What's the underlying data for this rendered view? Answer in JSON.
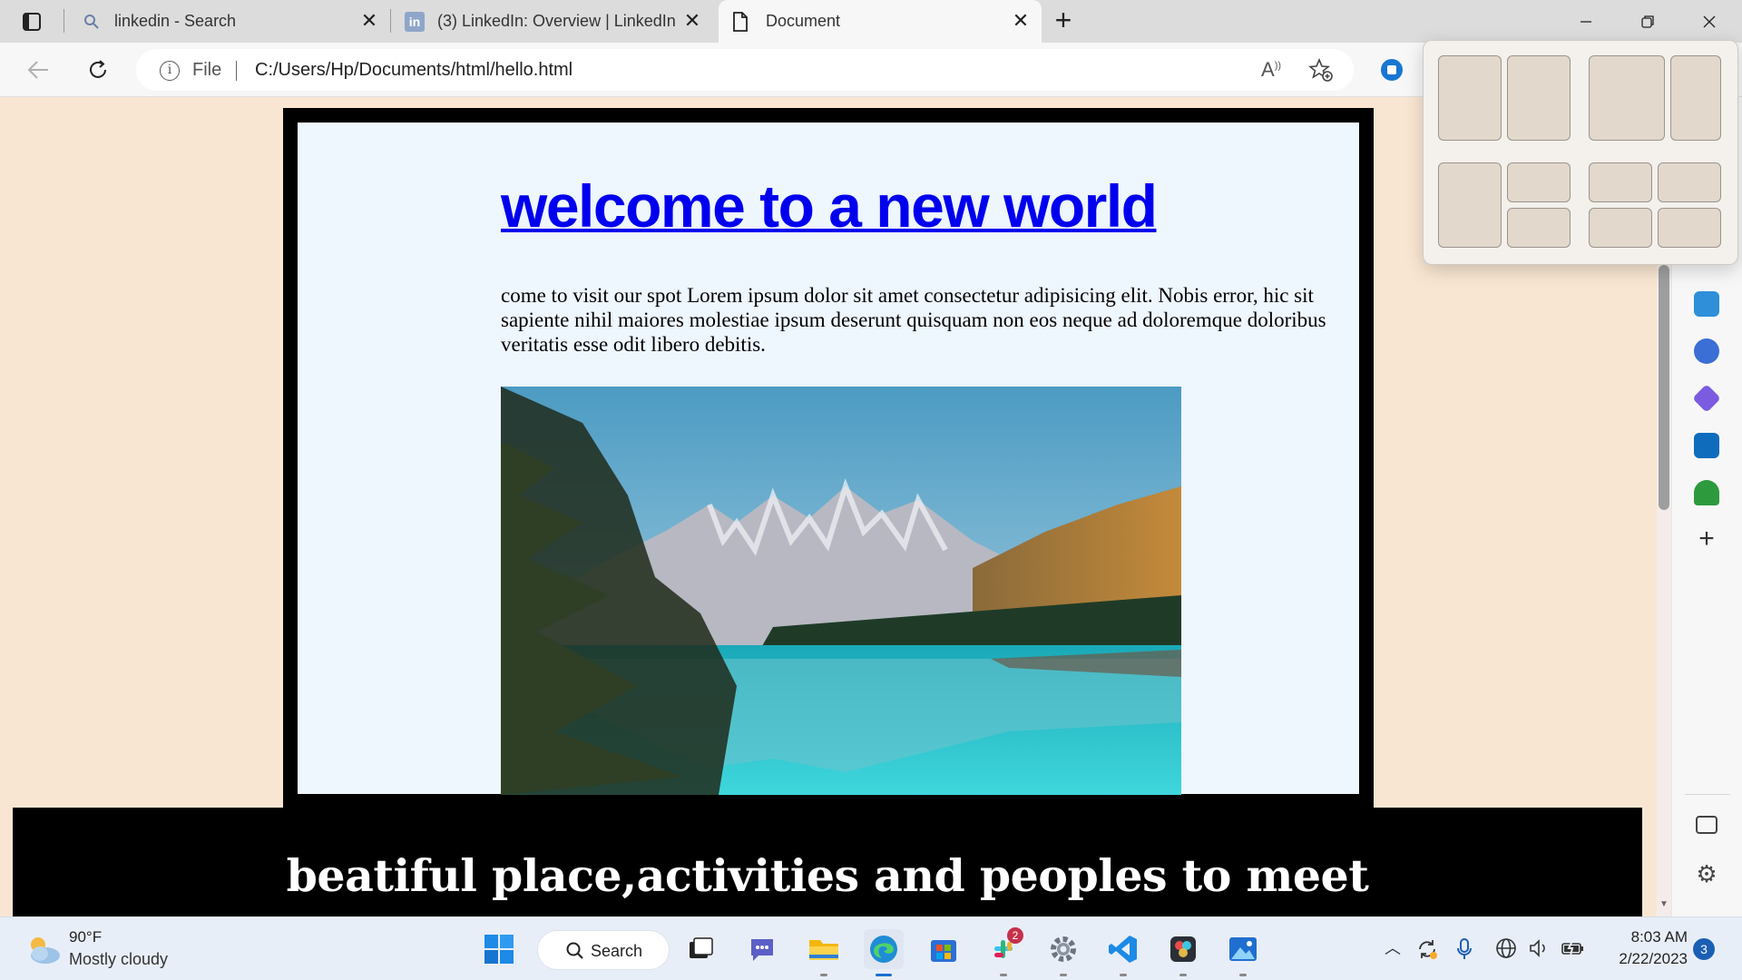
{
  "browser": {
    "tabs": [
      {
        "title": "linkedin - Search",
        "icon": "search-icon",
        "active": false
      },
      {
        "title": "(3) LinkedIn: Overview | LinkedIn",
        "icon": "linkedin-icon",
        "active": false
      },
      {
        "title": "Document",
        "icon": "document-icon",
        "active": true
      }
    ],
    "address": {
      "scheme": "File",
      "url": "C:/Users/Hp/Documents/html/hello.html"
    },
    "close_glyph": "✕"
  },
  "page": {
    "heading": "welcome to a new world",
    "paragraph": "come to visit our spot Lorem ipsum dolor sit amet consectetur adipisicing elit. Nobis error, hic sit sapiente nihil maiores molestiae ipsum deserunt quisquam non eos neque ad doloremque doloribus veritatis esse odit libero debitis.",
    "image_subject": "mountain-lake-landscape",
    "banner": "beatiful place,activities and peoples to meet"
  },
  "snap_layouts": {
    "visible": true,
    "layouts": [
      "two-equal",
      "two-wide-narrow",
      "left-half-right-stacked",
      "four-quadrants"
    ]
  },
  "taskbar": {
    "weather": {
      "temp": "90°F",
      "condition": "Mostly cloudy"
    },
    "search_label": "Search",
    "apps": [
      "windows-start",
      "search",
      "task-view",
      "teams-chat",
      "file-explorer",
      "edge",
      "microsoft-store",
      "slack",
      "settings",
      "vscode",
      "davinci-resolve",
      "photos"
    ],
    "slack_badge": "2",
    "clock": {
      "time": "8:03 AM",
      "date": "2/22/2023"
    },
    "notifications": "3"
  },
  "colors": {
    "page_bg": "#f9e6d2",
    "content_bg": "#eef6fe",
    "link": "#0000ee",
    "frame": "#000000"
  }
}
